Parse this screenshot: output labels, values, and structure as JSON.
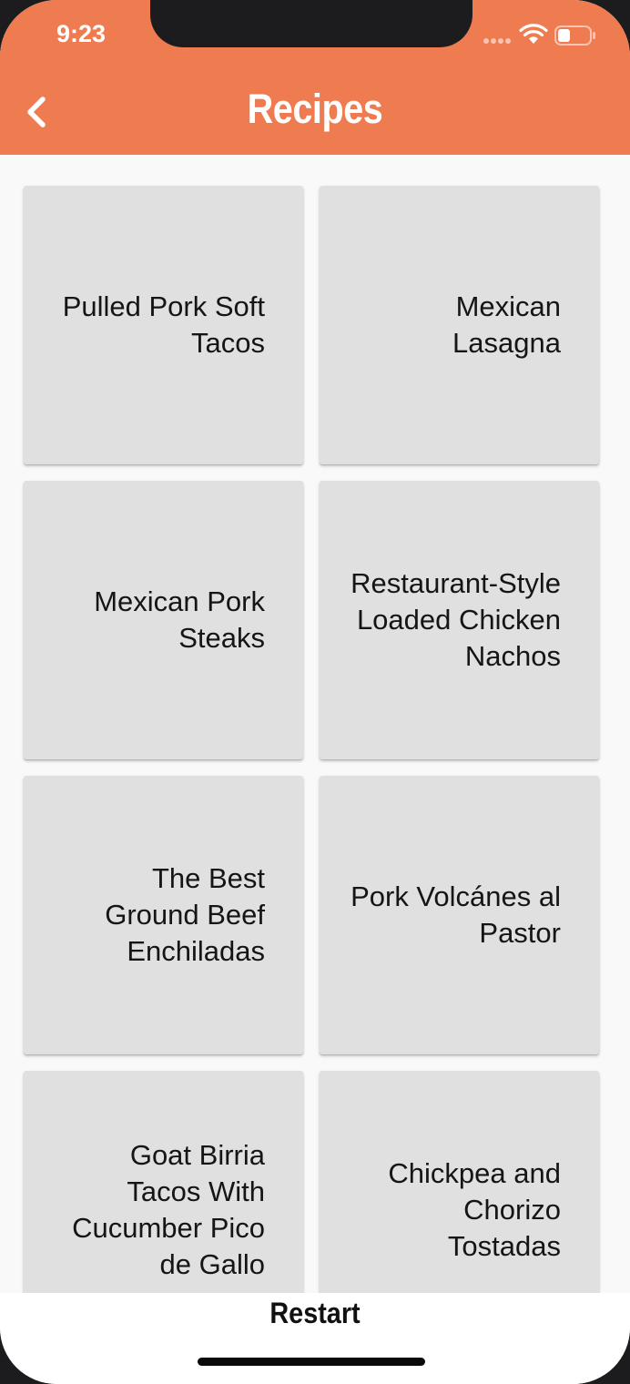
{
  "status_bar": {
    "time": "9:23",
    "icons": [
      "signal-icon",
      "wifi-icon",
      "battery-icon"
    ]
  },
  "app_bar": {
    "back_icon": "chevron-left-icon",
    "title": "Recipes",
    "background_color": "#ef7b50",
    "title_color": "#ffffff"
  },
  "recipes": [
    {
      "label": "Pulled Pork Soft Tacos"
    },
    {
      "label": "Mexican Lasagna"
    },
    {
      "label": "Mexican Pork Steaks"
    },
    {
      "label": "Restaurant-Style Loaded Chicken Nachos"
    },
    {
      "label": "The Best Ground Beef Enchiladas"
    },
    {
      "label": "Pork Volcánes al Pastor"
    },
    {
      "label": "Goat Birria Tacos With Cucumber Pico de Gallo"
    },
    {
      "label": "Chickpea and Chorizo Tostadas"
    }
  ],
  "card_color": "#e0e0e0",
  "bottom_bar": {
    "restart_label": "Restart"
  }
}
